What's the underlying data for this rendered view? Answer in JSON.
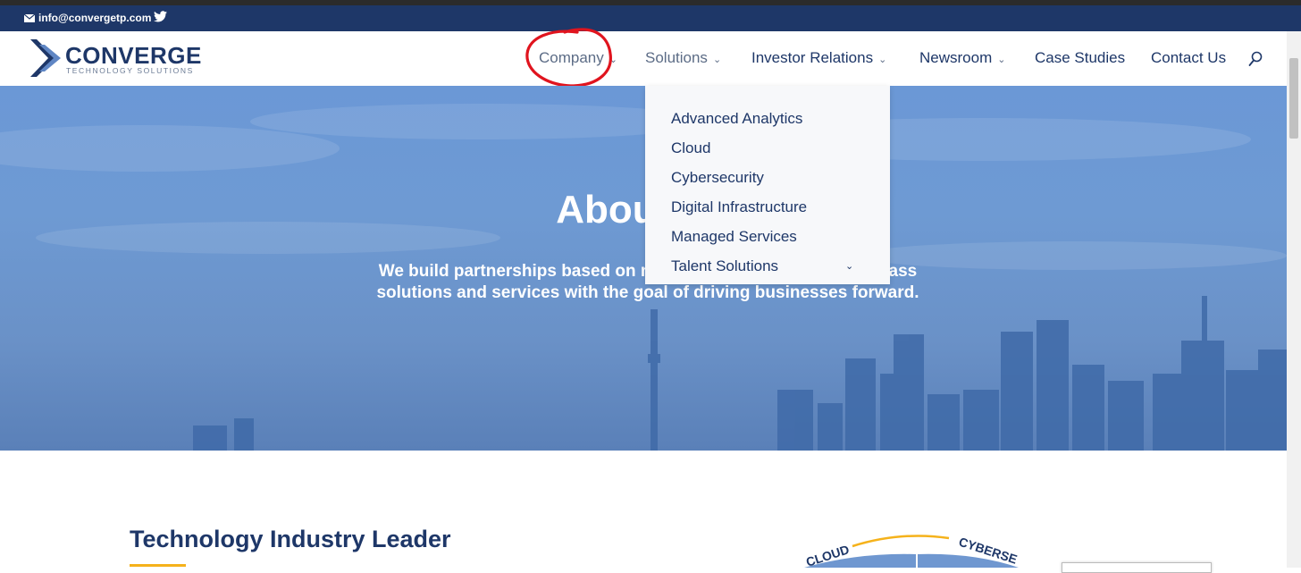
{
  "topbar": {
    "email": "info@convergetp.com",
    "email_icon": "envelope-icon",
    "social_icon": "twitter-icon"
  },
  "logo": {
    "name": "CONVERGE",
    "tagline": "TECHNOLOGY SOLUTIONS"
  },
  "nav": {
    "items": [
      {
        "label": "Company",
        "has_dropdown": true
      },
      {
        "label": "Solutions",
        "has_dropdown": true
      },
      {
        "label": "Investor Relations",
        "has_dropdown": true
      },
      {
        "label": "Newsroom",
        "has_dropdown": true
      },
      {
        "label": "Case Studies",
        "has_dropdown": false
      },
      {
        "label": "Contact Us",
        "has_dropdown": false
      }
    ],
    "search_icon": "search-icon"
  },
  "dropdown": {
    "items": [
      {
        "label": "Advanced Analytics"
      },
      {
        "label": "Cloud"
      },
      {
        "label": "Cybersecurity"
      },
      {
        "label": "Digital Infrastructure"
      },
      {
        "label": "Managed Services"
      },
      {
        "label": "Talent Solutions",
        "has_submenu": true
      }
    ]
  },
  "hero": {
    "title": "About Us",
    "text": "We build partnerships based on mutual trust to deliver world-class solutions and services with the goal of driving businesses forward."
  },
  "section": {
    "title": "Technology Industry Leader",
    "wheel_labels": [
      "CLOUD",
      "CYBERSE"
    ]
  },
  "colors": {
    "navy": "#1e3768",
    "accent": "#f5b21b",
    "annotation": "#e0141e"
  }
}
